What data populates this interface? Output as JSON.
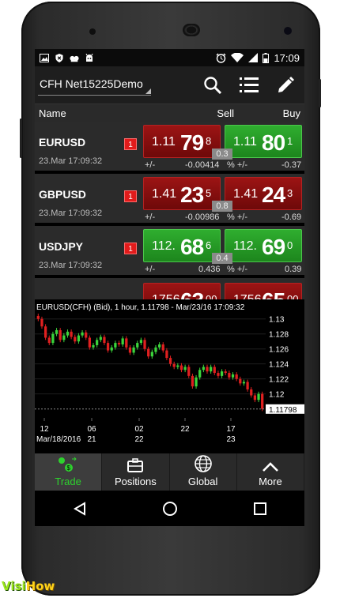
{
  "status_bar": {
    "time": "17:09",
    "left_icons": [
      "image-icon",
      "shield-icon",
      "cat-icon",
      "android-icon"
    ],
    "right_icons": [
      "alarm-icon",
      "wifi-icon",
      "signal-icon",
      "battery-icon"
    ]
  },
  "action_bar": {
    "account": "CFH Net15225Demo",
    "icons": [
      "search-icon",
      "list-icon",
      "edit-icon"
    ]
  },
  "columns": {
    "name": "Name",
    "sell": "Sell",
    "buy": "Buy"
  },
  "quotes": [
    {
      "symbol": "EURUSD",
      "lots": "1",
      "time": "23.Mar 17:09:32",
      "sell": {
        "prefix": "1.11",
        "big": "79",
        "frac": "8",
        "color": "red"
      },
      "buy": {
        "prefix": "1.11",
        "big": "80",
        "frac": "1",
        "color": "green"
      },
      "spread": "0.3",
      "change_label": "+/-",
      "change": "-0.00414",
      "pct_label": "% +/-",
      "pct": "-0.37"
    },
    {
      "symbol": "GBPUSD",
      "lots": "1",
      "time": "23.Mar 17:09:32",
      "sell": {
        "prefix": "1.41",
        "big": "23",
        "frac": "5",
        "color": "red"
      },
      "buy": {
        "prefix": "1.41",
        "big": "24",
        "frac": "3",
        "color": "red"
      },
      "spread": "0.8",
      "change_label": "+/-",
      "change": "-0.00986",
      "pct_label": "% +/-",
      "pct": "-0.69"
    },
    {
      "symbol": "USDJPY",
      "lots": "1",
      "time": "23.Mar 17:09:32",
      "sell": {
        "prefix": "112.",
        "big": "68",
        "frac": "6",
        "color": "green"
      },
      "buy": {
        "prefix": "112.",
        "big": "69",
        "frac": "0",
        "color": "green"
      },
      "spread": "0.4",
      "change_label": "+/-",
      "change": "0.436",
      "pct_label": "% +/-",
      "pct": "0.39"
    },
    {
      "symbol": "",
      "lots": "",
      "time": "",
      "sell": {
        "prefix": "1756",
        "big": "63",
        "frac": "00",
        "color": "red"
      },
      "buy": {
        "prefix": "1756",
        "big": "65",
        "frac": "00",
        "color": "red"
      },
      "spread": "",
      "change_label": "",
      "change": "",
      "pct_label": "",
      "pct": ""
    }
  ],
  "chart": {
    "title": "EURUSD(CFH) (Bid),  1 hour, 1.11798 - Mar/23/16 17:09:32",
    "y_ticks": [
      "1.13",
      "1.128",
      "1.126",
      "1.124",
      "1.122",
      "1.12"
    ],
    "current_price": "1.11798",
    "x_ticks": [
      {
        "top": "12",
        "bottom": "Mar/18/2016"
      },
      {
        "top": "06",
        "bottom": "21"
      },
      {
        "top": "02",
        "bottom": "22"
      },
      {
        "top": "22",
        "bottom": ""
      },
      {
        "top": "17",
        "bottom": "23"
      }
    ]
  },
  "chart_data": {
    "type": "candlestick",
    "title": "EURUSD(CFH) (Bid),  1 hour, 1.11798 - Mar/23/16 17:09:32",
    "ylim": [
      1.1168,
      1.1305
    ],
    "x_ticks": [
      "12 Mar/18/2016",
      "06 21",
      "02 22",
      "22",
      "17 23"
    ],
    "y_ticks": [
      1.13,
      1.128,
      1.126,
      1.124,
      1.122,
      1.12
    ],
    "current_price": 1.11798,
    "close": [
      1.13,
      1.129,
      1.1275,
      1.1268,
      1.128,
      1.1285,
      1.1272,
      1.1278,
      1.1283,
      1.1276,
      1.127,
      1.1278,
      1.1282,
      1.1275,
      1.1262,
      1.1265,
      1.1272,
      1.1276,
      1.1268,
      1.1258,
      1.1262,
      1.1268,
      1.1266,
      1.1274,
      1.1262,
      1.1255,
      1.1262,
      1.1268,
      1.1272,
      1.126,
      1.125,
      1.1256,
      1.1262,
      1.1266,
      1.1258,
      1.1248,
      1.124,
      1.1236,
      1.1238,
      1.1232,
      1.1236,
      1.1224,
      1.121,
      1.1222,
      1.1232,
      1.1236,
      1.123,
      1.1236,
      1.1228,
      1.1224,
      1.123,
      1.1228,
      1.1222,
      1.1226,
      1.122,
      1.1214,
      1.1216,
      1.1206,
      1.1198,
      1.1192,
      1.12,
      1.118
    ]
  },
  "tabs": [
    {
      "label": "Trade",
      "icon": "trade-icon",
      "active": true
    },
    {
      "label": "Positions",
      "icon": "briefcase-icon",
      "active": false
    },
    {
      "label": "Global",
      "icon": "globe-icon",
      "active": false
    },
    {
      "label": "More",
      "icon": "chevron-up-icon",
      "active": false
    }
  ],
  "nav": {
    "icons": [
      "back-icon",
      "home-icon",
      "recents-icon"
    ]
  },
  "watermark": {
    "part1": "Visi",
    "part2": "How"
  },
  "colors": {
    "sell_red": "#9c1414",
    "buy_green": "#2fae2f",
    "accent_green": "#2ed12e",
    "lots_red": "#e21b1b"
  }
}
